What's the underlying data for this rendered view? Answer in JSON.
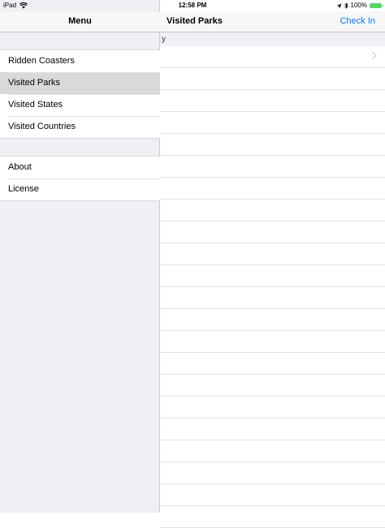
{
  "status": {
    "device": "iPad",
    "time": "12:58 PM",
    "battery": "100%"
  },
  "master": {
    "title": "Menu",
    "groups": [
      [
        "Ridden Coasters",
        "Visited Parks",
        "Visited States",
        "Visited Countries"
      ],
      [
        "About",
        "License"
      ]
    ],
    "selected": "Visited Parks"
  },
  "detail": {
    "title": "Visited Parks",
    "action": "Check In",
    "section_header": "y"
  },
  "colors": {
    "accent": "#007aff",
    "selected_row": "#d9d9d9",
    "background": "#efeff4"
  }
}
